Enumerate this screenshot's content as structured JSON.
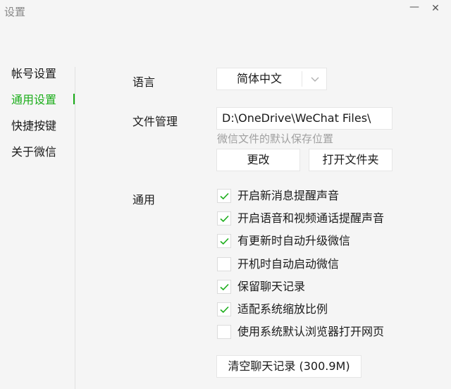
{
  "window": {
    "title": "设置",
    "minimize_glyph": "—",
    "close_glyph": "✕"
  },
  "sidebar": {
    "items": [
      {
        "label": "帐号设置"
      },
      {
        "label": "通用设置",
        "active": true
      },
      {
        "label": "快捷按键"
      },
      {
        "label": "关于微信"
      }
    ]
  },
  "language": {
    "label": "语言",
    "value": "简体中文",
    "icon": "chevron-down-icon"
  },
  "files": {
    "label": "文件管理",
    "path": "D:\\OneDrive\\WeChat Files\\",
    "hint": "微信文件的默认保存位置",
    "change_label": "更改",
    "open_label": "打开文件夹"
  },
  "general": {
    "label": "通用",
    "options": [
      {
        "label": "开启新消息提醒声音",
        "checked": true
      },
      {
        "label": "开启语音和视频通话提醒声音",
        "checked": true
      },
      {
        "label": "有更新时自动升级微信",
        "checked": true
      },
      {
        "label": "开机时自动启动微信",
        "checked": false
      },
      {
        "label": "保留聊天记录",
        "checked": true
      },
      {
        "label": "适配系统缩放比例",
        "checked": true
      },
      {
        "label": "使用系统默认浏览器打开网页",
        "checked": false
      }
    ],
    "clear_label": "清空聊天记录 (300.9M)"
  },
  "colors": {
    "accent": "#1aad19",
    "background": "#f5f5f5",
    "hint": "#a0a0a0"
  }
}
